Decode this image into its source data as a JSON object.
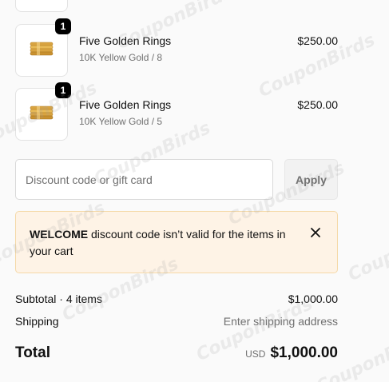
{
  "items": [
    {
      "name": "Five Golden Rings",
      "variant": "10K Yellow Gold / 8",
      "price": "$250.00",
      "quantity": "1",
      "image_icon": "gold-rings-icon"
    },
    {
      "name": "Five Golden Rings",
      "variant": "10K Yellow Gold / 5",
      "price": "$250.00",
      "quantity": "1",
      "image_icon": "gold-rings-icon"
    }
  ],
  "discount": {
    "placeholder": "Discount code or gift card",
    "value": "",
    "apply_label": "Apply"
  },
  "notice": {
    "code": "WELCOME",
    "message": " discount code isn’t valid for the items in your cart",
    "close_icon": "close-icon",
    "background_color": "#fef3e6",
    "border_color": "#f5d9a8"
  },
  "summary": {
    "subtotal_label": "Subtotal · 4 items",
    "subtotal_value": "$1,000.00",
    "shipping_label": "Shipping",
    "shipping_value": "Enter shipping address",
    "total_label": "Total",
    "total_currency": "USD",
    "total_value": "$1,000.00"
  },
  "watermark": "CouponBirds"
}
